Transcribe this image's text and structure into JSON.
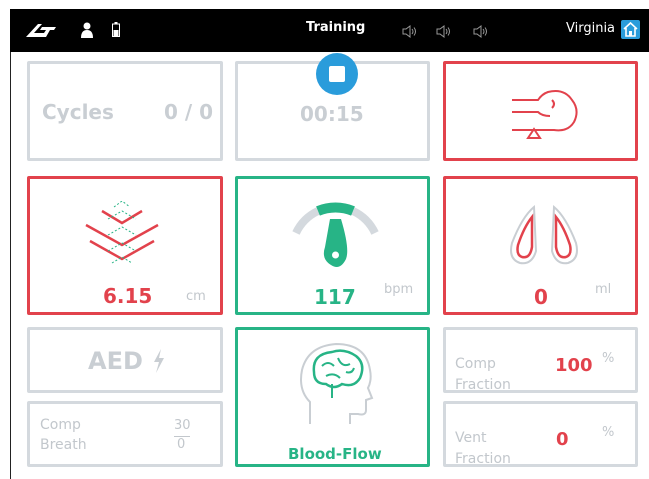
{
  "topbar": {
    "mode_title": "Training",
    "user_name": "Virginia"
  },
  "cycles": {
    "label": "Cycles",
    "value": "0 / 0"
  },
  "timer": {
    "value": "00:15"
  },
  "compression": {
    "depth": "6.15",
    "unit": "cm"
  },
  "rate": {
    "value": "117",
    "unit": "bpm"
  },
  "ventilation": {
    "volume": "0",
    "unit": "ml"
  },
  "aed": {
    "label": "AED"
  },
  "blood_flow": {
    "label": "Blood-Flow"
  },
  "comp_breath": {
    "label_line1": "Comp",
    "label_line2": "Breath",
    "comp_value": "30",
    "breath_value": "0"
  },
  "comp_fraction": {
    "label_line1": "Comp",
    "label_line2": "Fraction",
    "value": "100",
    "unit": "%"
  },
  "vent_fraction": {
    "label_line1": "Vent",
    "label_line2": "Fraction",
    "value": "0",
    "unit": "%"
  },
  "colors": {
    "red": "#e2424c",
    "green": "#27b486",
    "gray": "#d4d9de",
    "blue": "#2a9cdb"
  },
  "icons": [
    "logo-icon",
    "person-icon",
    "battery-icon",
    "speaker-icon",
    "home-icon",
    "stop-icon",
    "airway-head-icon",
    "compression-chevron-icon",
    "rate-gauge-icon",
    "lungs-icon",
    "lightning-icon",
    "brain-head-icon"
  ]
}
